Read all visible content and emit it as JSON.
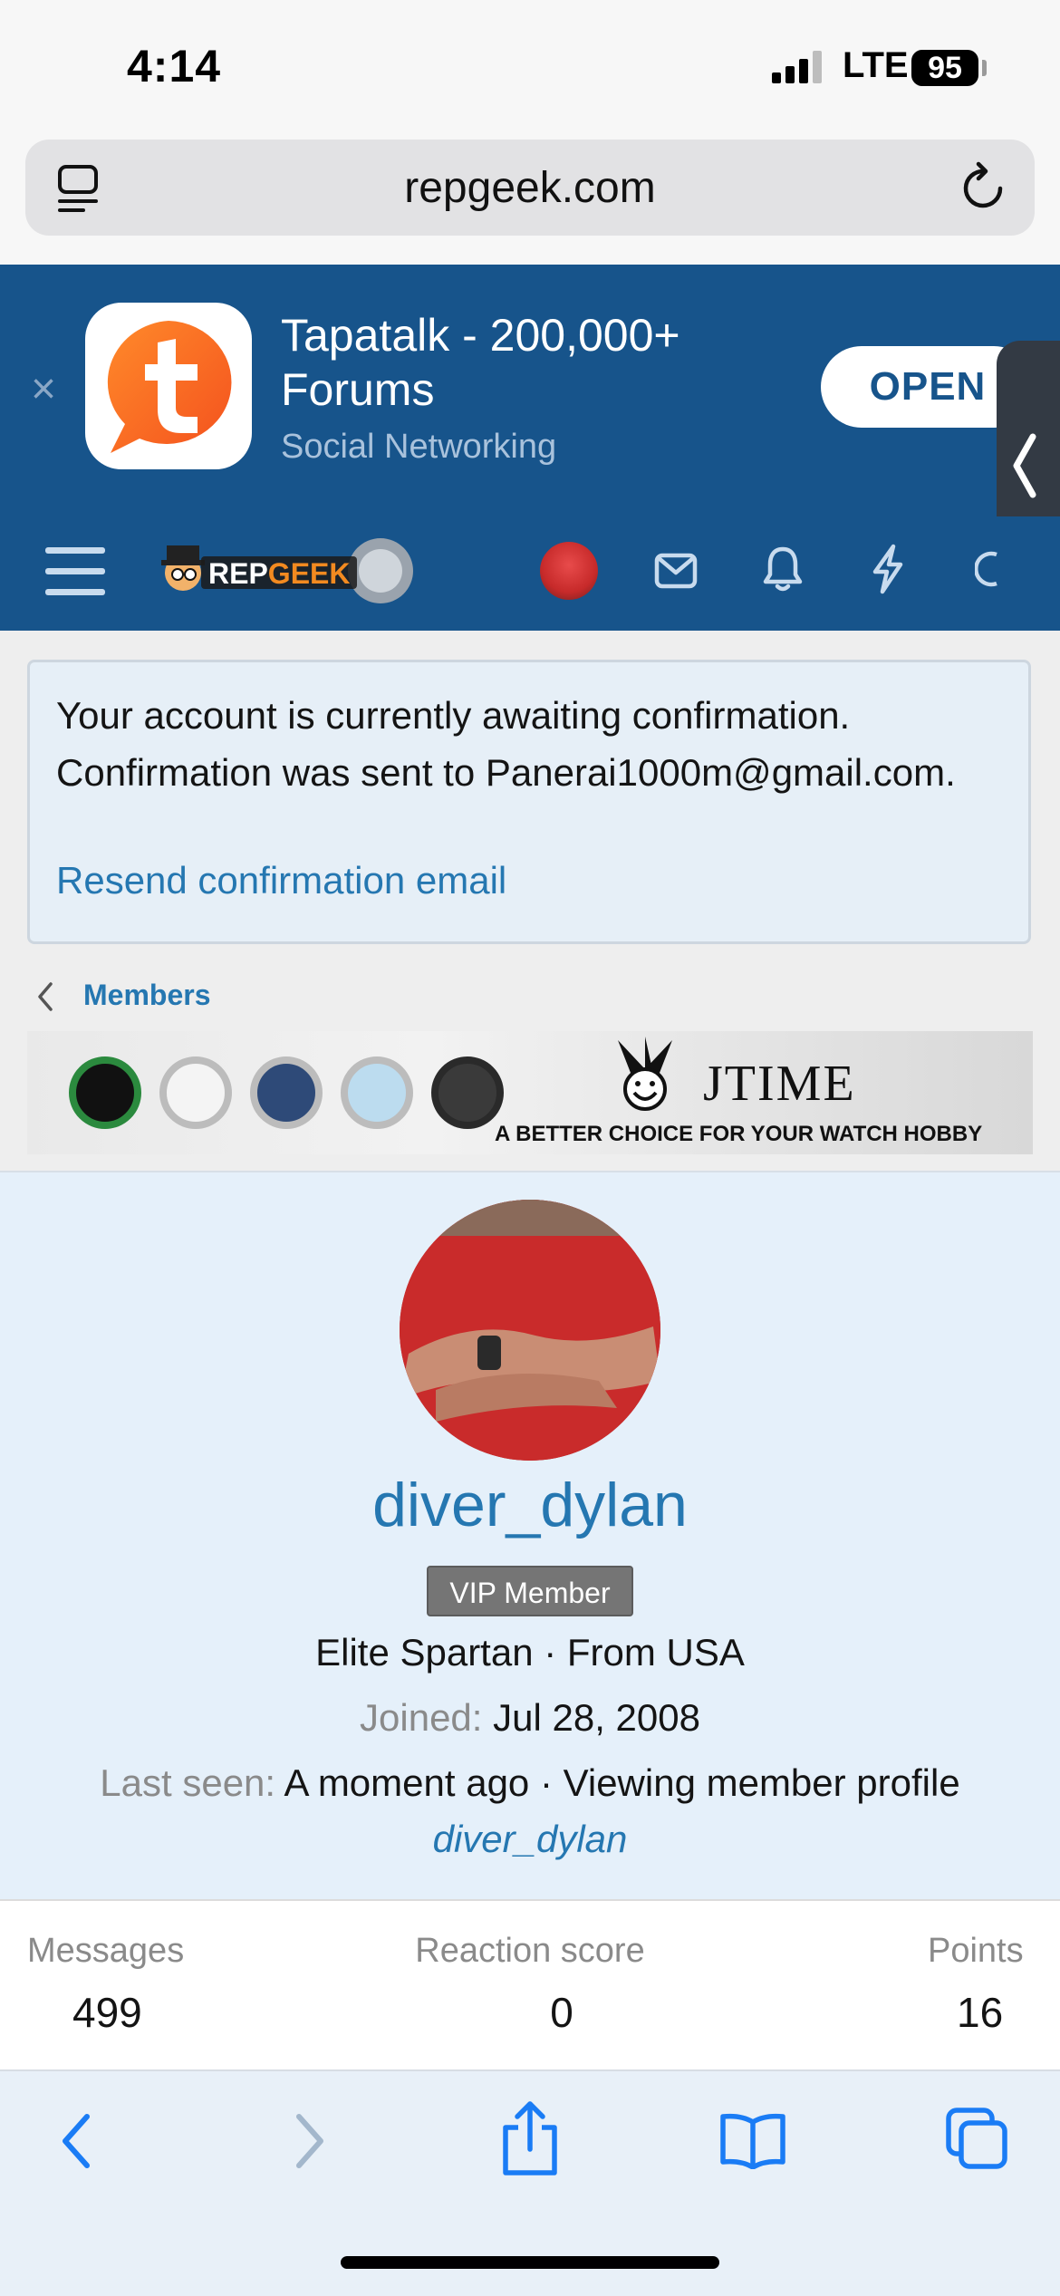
{
  "status_bar": {
    "time": "4:14",
    "network": "LTE",
    "battery": "95"
  },
  "browser": {
    "url": "repgeek.com"
  },
  "app_banner": {
    "title": "Tapatalk - 200,000+ Forums",
    "subtitle": "Social Networking",
    "open_label": "OPEN",
    "close_glyph": "×"
  },
  "forum_header": {
    "logo_text": "REPGEEK"
  },
  "notice": {
    "message": "Your account is currently awaiting confirmation. Confirmation was sent to Panerai1000m@gmail.com.",
    "resend_link": "Resend confirmation email"
  },
  "breadcrumb": {
    "label": "Members"
  },
  "ad": {
    "brand": "JTIME",
    "tagline": "A BETTER CHOICE FOR YOUR WATCH HOBBY"
  },
  "profile": {
    "username": "diver_dylan",
    "badge": "VIP Member",
    "user_title": "Elite Spartan · From USA",
    "joined_label": "Joined:",
    "joined_value": "Jul 28, 2008",
    "last_seen_label": "Last seen:",
    "last_seen_value": "A moment ago · Viewing member profile",
    "activity_link": "diver_dylan"
  },
  "stats": [
    {
      "label": "Messages",
      "value": "499"
    },
    {
      "label": "Reaction score",
      "value": "0"
    },
    {
      "label": "Points",
      "value": "16"
    }
  ],
  "colors": {
    "forum_blue": "#17548b",
    "link_blue": "#2577b1",
    "notice_bg": "#e6eff7",
    "profile_bg": "#e5f0fa",
    "toolbar_icon": "#1a7cf5",
    "tapatalk_orange": "#ff6a1a"
  },
  "icons": [
    "signal-icon",
    "reader-mode-icon",
    "reload-icon",
    "close-icon",
    "tapatalk-icon",
    "menu-icon",
    "inbox-icon",
    "alerts-icon",
    "whats-new-icon",
    "search-icon",
    "chevron-left-icon",
    "back-icon",
    "forward-icon",
    "share-icon",
    "bookmarks-icon",
    "tabs-icon"
  ]
}
